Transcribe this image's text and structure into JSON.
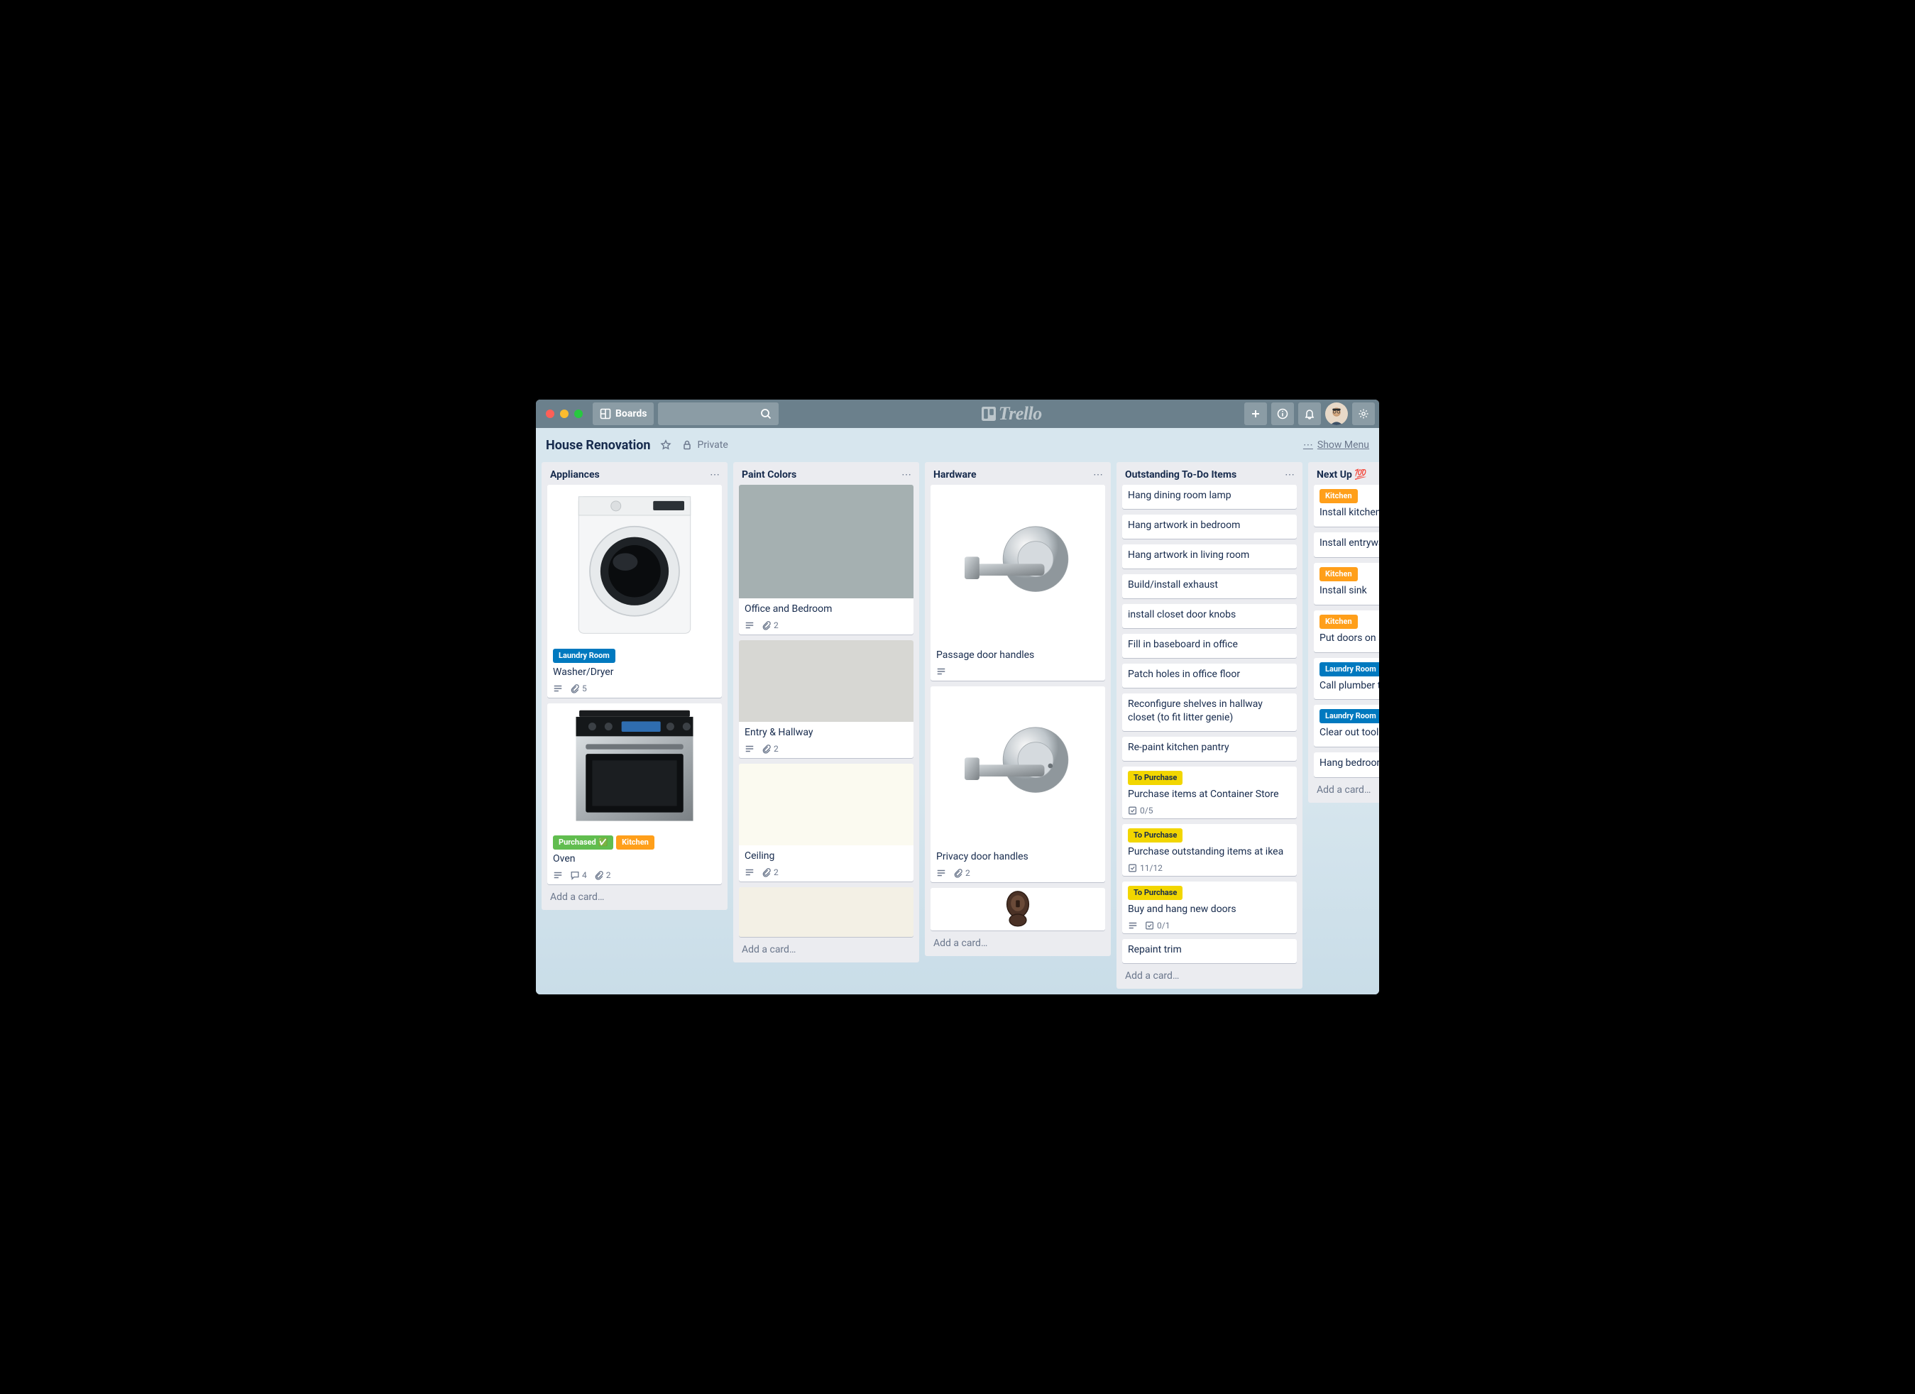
{
  "topbar": {
    "boards_label": "Boards",
    "logo_text": "Trello"
  },
  "board_header": {
    "title": "House Renovation",
    "visibility": "Private",
    "show_menu": "Show Menu"
  },
  "label_colors": {
    "Laundry Room": "#0079bf",
    "Purchased ✅": "#61bd4f",
    "Kitchen": "#ff9f1a",
    "To Purchase": "#f2d600"
  },
  "add_card_text": "Add a card…",
  "lists": [
    {
      "title": "Appliances",
      "cards": [
        {
          "cover": {
            "type": "image",
            "key": "washer",
            "height": "tall"
          },
          "labels": [
            "Laundry Room"
          ],
          "title": "Washer/Dryer",
          "badges": {
            "desc": true,
            "attachments": 5
          }
        },
        {
          "cover": {
            "type": "image",
            "key": "oven",
            "height": "short",
            "extra": 60
          },
          "labels": [
            "Purchased ✅",
            "Kitchen"
          ],
          "title": "Oven",
          "badges": {
            "desc": true,
            "comments": 4,
            "attachments": 2
          }
        }
      ]
    },
    {
      "title": "Paint Colors",
      "cards": [
        {
          "cover": {
            "type": "color",
            "color": "#a5b0b1",
            "height": "normal"
          },
          "title": "Office and Bedroom",
          "badges": {
            "desc": true,
            "attachments": 2
          }
        },
        {
          "cover": {
            "type": "color",
            "color": "#d7d7d3",
            "height": "short"
          },
          "title": "Entry & Hallway",
          "badges": {
            "desc": true,
            "attachments": 2
          }
        },
        {
          "cover": {
            "type": "color",
            "color": "#fbfaf0",
            "height": "short"
          },
          "title": "Ceiling",
          "badges": {
            "desc": true,
            "attachments": 2
          }
        },
        {
          "cover": {
            "type": "color",
            "color": "#f3f0e5",
            "height": "short",
            "partial": true
          }
        }
      ]
    },
    {
      "title": "Hardware",
      "cards": [
        {
          "cover": {
            "type": "image",
            "key": "handle1",
            "height": "tall"
          },
          "title": "Passage door handles",
          "badges": {
            "desc": true
          }
        },
        {
          "cover": {
            "type": "image",
            "key": "handle2",
            "height": "tall"
          },
          "title": "Privacy door handles",
          "badges": {
            "desc": true,
            "attachments": 2
          }
        },
        {
          "cover": {
            "type": "image",
            "key": "deadbolt",
            "height": "short",
            "partial": true
          }
        }
      ]
    },
    {
      "title": "Outstanding To-Do Items",
      "cards": [
        {
          "title": "Hang dining room lamp"
        },
        {
          "title": "Hang artwork in bedroom"
        },
        {
          "title": "Hang artwork in living room"
        },
        {
          "title": "Build/install exhaust"
        },
        {
          "title": "install closet door knobs"
        },
        {
          "title": "Fill in baseboard in office"
        },
        {
          "title": "Patch holes in office floor"
        },
        {
          "title": "Reconfigure shelves in hallway closet (to fit litter genie)"
        },
        {
          "title": "Re-paint kitchen pantry"
        },
        {
          "labels": [
            "To Purchase"
          ],
          "title": "Purchase items at Container Store",
          "badges": {
            "checklist": "0/5"
          }
        },
        {
          "labels": [
            "To Purchase"
          ],
          "title": "Purchase outstanding items at ikea",
          "badges": {
            "checklist": "11/12"
          }
        },
        {
          "labels": [
            "To Purchase"
          ],
          "title": "Buy and hang new doors",
          "badges": {
            "desc": true,
            "checklist": "0/1"
          }
        },
        {
          "title": "Repaint trim"
        }
      ]
    },
    {
      "title": "Next Up 💯",
      "cards": [
        {
          "labels": [
            "Kitchen"
          ],
          "title": "Install kitchen"
        },
        {
          "title": "Install entrywa"
        },
        {
          "labels": [
            "Kitchen"
          ],
          "title": "Install sink"
        },
        {
          "labels": [
            "Kitchen"
          ],
          "title": "Put doors on s"
        },
        {
          "labels": [
            "Laundry Room"
          ],
          "title": "Call plumber to ups",
          "multiline": true
        },
        {
          "labels": [
            "Laundry Room"
          ],
          "title": "Clear out tools"
        },
        {
          "title": "Hang bedroom"
        }
      ]
    }
  ]
}
